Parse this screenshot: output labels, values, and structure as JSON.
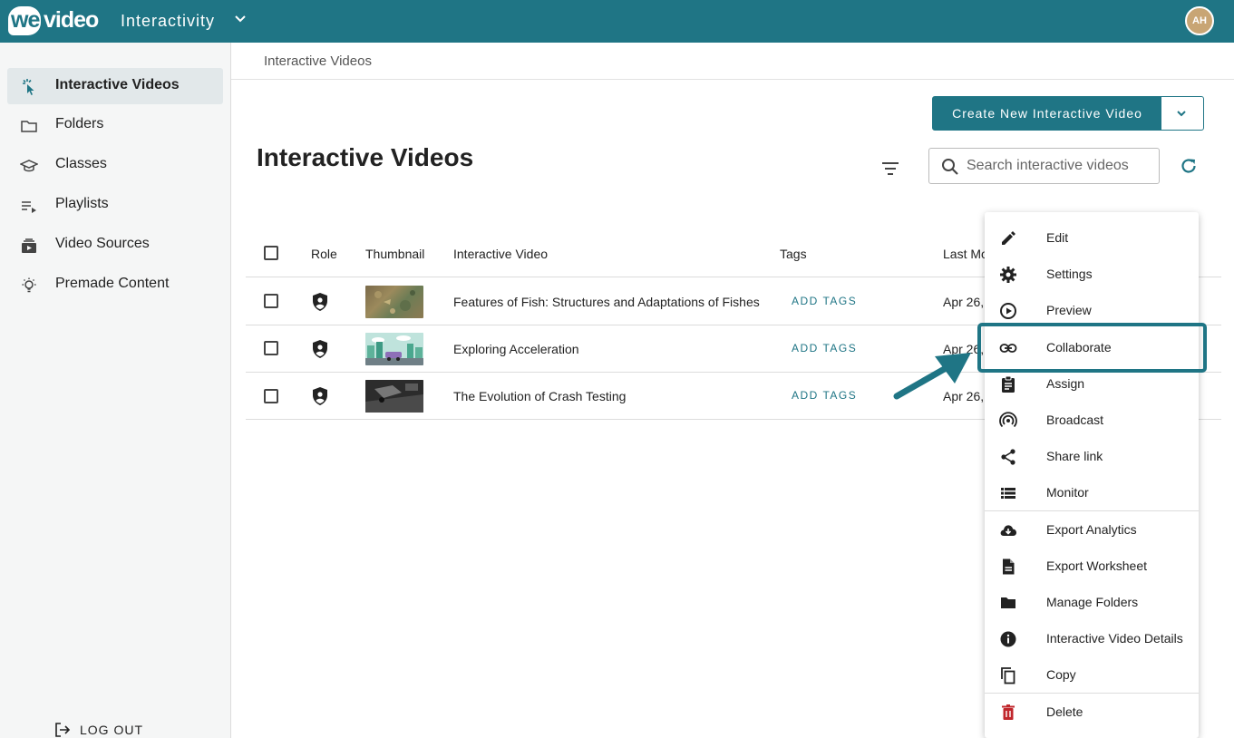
{
  "brand": {
    "logo_we": "we",
    "logo_video": "video",
    "app_name": "Interactivity",
    "accent": "#1f7585"
  },
  "user": {
    "initials": "AH"
  },
  "sidebar": {
    "items": [
      {
        "label": "Interactive Videos",
        "icon": "touch-icon",
        "active": true
      },
      {
        "label": "Folders",
        "icon": "folder-icon"
      },
      {
        "label": "Classes",
        "icon": "graduation-cap-icon"
      },
      {
        "label": "Playlists",
        "icon": "playlist-icon"
      },
      {
        "label": "Video Sources",
        "icon": "video-library-icon"
      },
      {
        "label": "Premade Content",
        "icon": "lightbulb-icon"
      }
    ],
    "logout_label": "LOG OUT"
  },
  "breadcrumb": "Interactive Videos",
  "toolbar": {
    "create_label": "Create New Interactive Video",
    "search_placeholder": "Search interactive videos"
  },
  "page_title": "Interactive Videos",
  "table": {
    "columns": [
      "Role",
      "Thumbnail",
      "Interactive Video",
      "Tags",
      "Last Mo"
    ],
    "rows": [
      {
        "title": "Features of Fish: Structures and Adaptations of Fishes",
        "tags": "ADD TAGS",
        "date": "Apr 26,"
      },
      {
        "title": "Exploring Acceleration",
        "tags": "ADD TAGS",
        "date": "Apr 26,"
      },
      {
        "title": "The Evolution of Crash Testing",
        "tags": "ADD TAGS",
        "date": "Apr 26,"
      }
    ]
  },
  "menu": {
    "items": [
      {
        "label": "Edit",
        "icon": "pencil-icon"
      },
      {
        "label": "Settings",
        "icon": "gear-icon"
      },
      {
        "label": "Preview",
        "icon": "play-circle-icon"
      },
      {
        "label": "Collaborate",
        "icon": "link-icon",
        "highlighted": true
      },
      {
        "label": "Assign",
        "icon": "clipboard-icon"
      },
      {
        "label": "Broadcast",
        "icon": "broadcast-icon"
      },
      {
        "label": "Share link",
        "icon": "share-icon"
      },
      {
        "label": "Monitor",
        "icon": "list-icon"
      },
      {
        "label": "Export Analytics",
        "icon": "cloud-download-icon"
      },
      {
        "label": "Export Worksheet",
        "icon": "document-icon"
      },
      {
        "label": "Manage Folders",
        "icon": "folder-filled-icon"
      },
      {
        "label": "Interactive Video Details",
        "icon": "info-icon"
      },
      {
        "label": "Copy",
        "icon": "copy-icon"
      },
      {
        "label": "Delete",
        "icon": "trash-icon"
      }
    ]
  }
}
